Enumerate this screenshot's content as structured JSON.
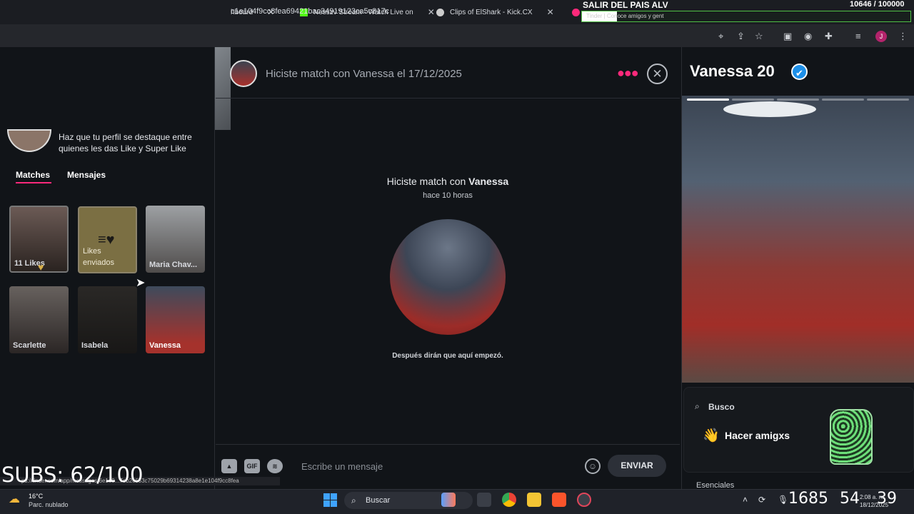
{
  "browser": {
    "tabs": [
      {
        "label": "hboard",
        "favicon_color": "#888888"
      },
      {
        "label": "Nesszv Stream - Watch Live on",
        "favicon_color": "#53fc18"
      },
      {
        "label": "Clips of ElShark - Kick.CX",
        "favicon_color": "#dddddd"
      },
      {
        "label": "Tinder | Conoce amigos y gent",
        "favicon_color": "#fd297b"
      }
    ],
    "url": "c1e104f9cc8fea69421bac34919123ca5c817c",
    "profile_initial": "J"
  },
  "overlay": {
    "goal_title": "SALIR DEL PAIS ALV",
    "goal_count": "10646 / 100000",
    "goal_progress": 0.106,
    "subs": "SUBS: 62/100",
    "status_url": "ps://tinder.com/app/messages/6e1e9...7eb2c653c75029b69314238a8e1e104f9cc8fea"
  },
  "left": {
    "boost_text": "Haz que tu perfil se destaque entre quienes les das Like y Super Like",
    "tabs": [
      "Matches",
      "Mensajes"
    ],
    "active_tab": "Matches",
    "cards": [
      {
        "label": "11 Likes",
        "type": "likes"
      },
      {
        "label": "Likes enviados",
        "type": "sent"
      },
      {
        "label": "Maria Chav...",
        "type": "p1"
      },
      {
        "label": "Scarlette",
        "type": "p2"
      },
      {
        "label": "Isabela",
        "type": "p3"
      },
      {
        "label": "Vanessa",
        "type": "p4"
      }
    ]
  },
  "chat": {
    "header_title": "Hiciste match con Vanessa el 17/12/2025",
    "match_prefix": "Hiciste match con",
    "match_name": "Vanessa",
    "match_time": "hace 10 horas",
    "quote": "Después dirán que aquí empezó.",
    "composer": {
      "gif_label": "GIF",
      "placeholder": "Escribe un mensaje",
      "send_label": "ENVIAR"
    }
  },
  "profile": {
    "name": "Vanessa",
    "age": "20",
    "photo_count": 5,
    "active_photo": 0,
    "busco_label": "Busco",
    "busco_value": "Hacer amigxs",
    "section_label": "Esenciales"
  },
  "taskbar": {
    "temperature": "16°C",
    "weather": "Parc. nublado",
    "search_label": "Buscar",
    "clock_big": [
      "1685",
      "54",
      "39"
    ],
    "clock_small_time": "2:08 a. m.",
    "clock_small_date": "18/12/2025"
  },
  "colors": {
    "accent": "#fd297b",
    "verified": "#1d8fe8",
    "goal_border": "#4fbf45"
  }
}
